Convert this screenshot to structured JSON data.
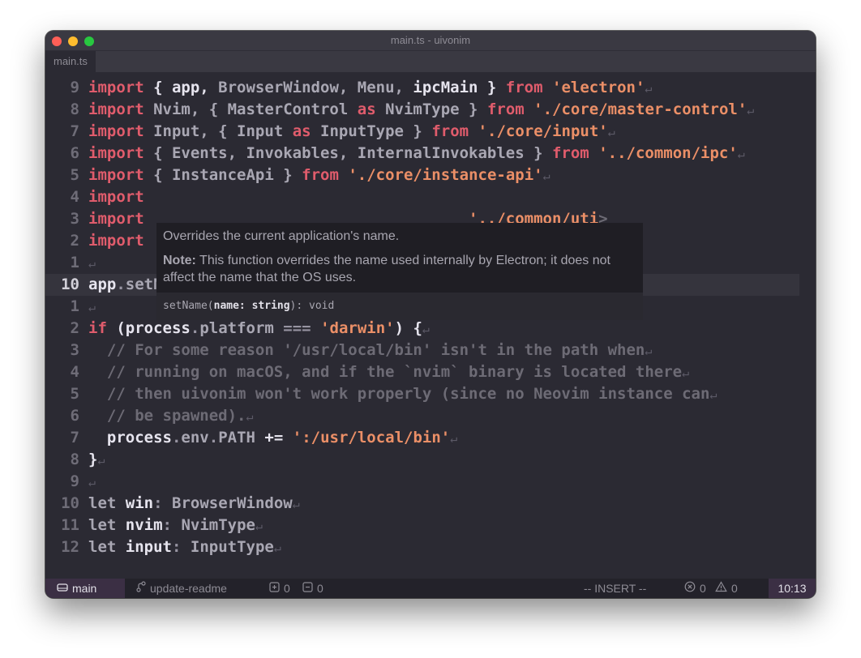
{
  "window": {
    "title": "main.ts - uivonim",
    "tab": "main.ts"
  },
  "editor": {
    "lines": [
      {
        "num": "9"
      },
      {
        "num": "8"
      },
      {
        "num": "7"
      },
      {
        "num": "6"
      },
      {
        "num": "5"
      },
      {
        "num": "4"
      },
      {
        "num": "3"
      },
      {
        "num": "2"
      },
      {
        "num": "1"
      },
      {
        "num": "10"
      },
      {
        "num": "1"
      },
      {
        "num": "2"
      },
      {
        "num": "3"
      },
      {
        "num": "4"
      },
      {
        "num": "5"
      },
      {
        "num": "6"
      },
      {
        "num": "7"
      },
      {
        "num": "8"
      },
      {
        "num": "9"
      },
      {
        "num": "10"
      },
      {
        "num": "11"
      },
      {
        "num": "12"
      }
    ]
  },
  "tooltip": {
    "description": "Overrides the current application's name.",
    "note_label": "Note:",
    "note_text": " This function overrides the name used internally by Electron; it does not affect the name that the OS uses.",
    "signature_name": "setName",
    "signature_param": "name: string",
    "signature_rest": "): void"
  },
  "statusbar": {
    "branch_main": "main",
    "branch_other": "update-readme",
    "added": "0",
    "removed": "0",
    "mode": "-- INSERT --",
    "errors": "0",
    "warnings": "0",
    "time": "10:13"
  },
  "colors": {
    "keyword": "#e05c6c",
    "string": "#eb8f67",
    "comment": "#6d6b75",
    "accent": "#e24aa0"
  }
}
